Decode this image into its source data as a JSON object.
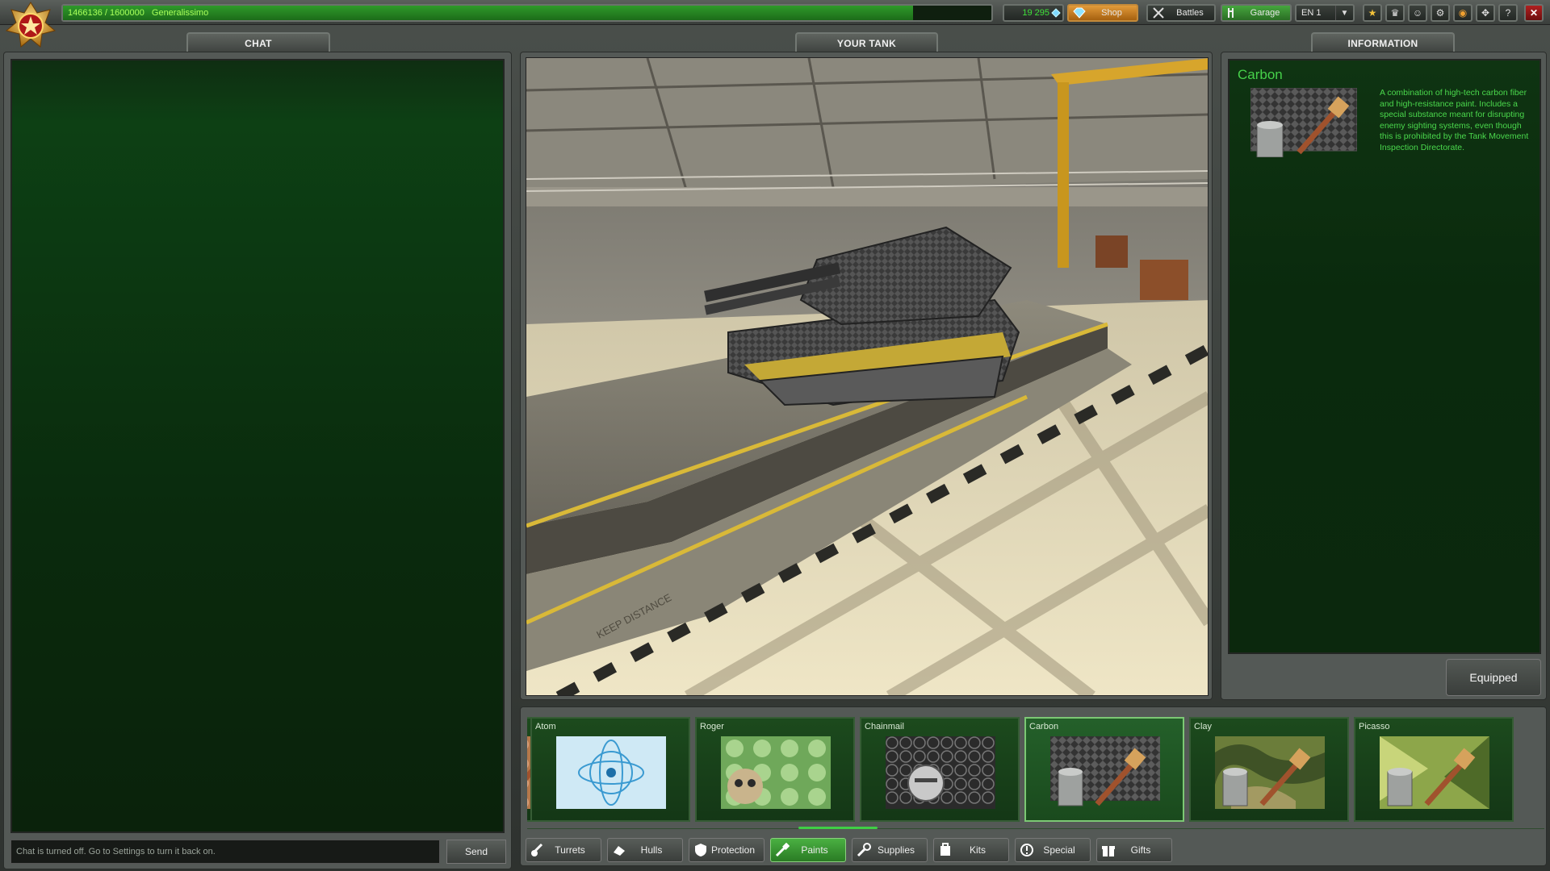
{
  "topbar": {
    "xp": "1466136 / 1600000",
    "xp_progress": 0.916,
    "rank": "Generalissimo",
    "crystals": "19 295",
    "shop": "Shop",
    "battles": "Battles",
    "garage": "Garage",
    "language": "EN 1",
    "icons": [
      "star-icon",
      "trophy-icon",
      "friends-icon",
      "settings-icon",
      "sound-icon",
      "fullscreen-icon",
      "help-icon",
      "close-icon"
    ]
  },
  "chat": {
    "tab": "CHAT",
    "input_placeholder": "Chat is turned off. Go to Settings to turn it back on.",
    "send": "Send"
  },
  "tank": {
    "tab": "YOUR TANK",
    "floor_text": "KEEP DISTANCE"
  },
  "info": {
    "tab": "INFORMATION",
    "title": "Carbon",
    "description": "A combination of high-tech carbon fiber and high-resistance paint. Includes a special substance meant for disrupting enemy sighting systems, even though this is prohibited by the Tank Movement Inspection Directorate.",
    "equipped": "Equipped"
  },
  "items": [
    {
      "name": "",
      "pattern": "copper"
    },
    {
      "name": "Atom",
      "pattern": "atom"
    },
    {
      "name": "Roger",
      "pattern": "roger"
    },
    {
      "name": "Chainmail",
      "pattern": "chainmail"
    },
    {
      "name": "Carbon",
      "pattern": "carbon",
      "selected": true
    },
    {
      "name": "Clay",
      "pattern": "camo"
    },
    {
      "name": "Picasso",
      "pattern": "picasso"
    }
  ],
  "categories": [
    {
      "label": "Turrets",
      "icon": "turret-icon"
    },
    {
      "label": "Hulls",
      "icon": "hull-icon"
    },
    {
      "label": "Protection",
      "icon": "shield-icon"
    },
    {
      "label": "Paints",
      "icon": "paint-brush-icon",
      "active": true
    },
    {
      "label": "Supplies",
      "icon": "wrench-icon"
    },
    {
      "label": "Kits",
      "icon": "kit-icon"
    },
    {
      "label": "Special",
      "icon": "special-icon"
    },
    {
      "label": "Gifts",
      "icon": "gift-icon"
    }
  ],
  "colors": {
    "accent_green": "#46d14a",
    "shop_orange": "#e39b3a",
    "close_red": "#b02020"
  }
}
